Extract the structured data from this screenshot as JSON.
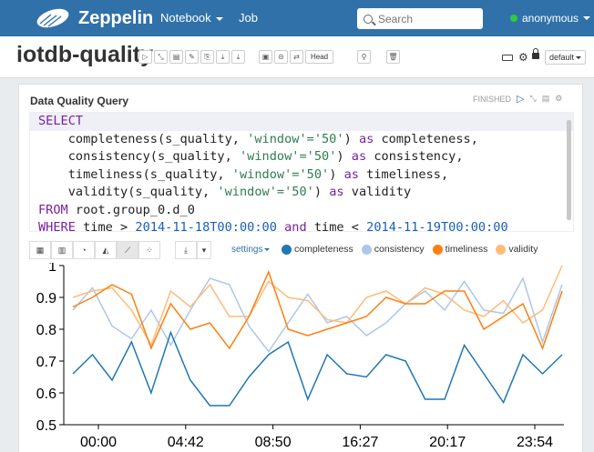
{
  "app": {
    "brand": "Zeppelin"
  },
  "nav": {
    "notebook": "Notebook",
    "job": "Job"
  },
  "search": {
    "placeholder": "Search"
  },
  "user": {
    "name": "anonymous"
  },
  "notebook": {
    "title": "iotdb-quality",
    "head_label": "Head",
    "interpreter": "default"
  },
  "paragraph": {
    "title": "Data Quality Query",
    "status": "FINISHED",
    "code": {
      "select": "SELECT",
      "f1_a": "    completeness(s_quality, ",
      "f1_s": "'window'='50'",
      "f1_b": ") ",
      "f1_as": "as",
      "f1_c": " completeness,",
      "f2_a": "    consistency(s_quality, ",
      "f2_s": "'window'='50'",
      "f2_b": ") ",
      "f2_as": "as",
      "f2_c": " consistency,",
      "f3_a": "    timeliness(s_quality, ",
      "f3_s": "'window'='50'",
      "f3_b": ") ",
      "f3_as": "as",
      "f3_c": " timeliness,",
      "f4_a": "    validity(s_quality, ",
      "f4_s": "'window'='50'",
      "f4_b": ") ",
      "f4_as": "as",
      "f4_c": " validity",
      "from_kw": "FROM",
      "from_rest": " root.group_0.d_0",
      "where_kw": "WHERE",
      "w1": " time > ",
      "d1": "2014-11-18T00:00:00",
      "and_kw": " and",
      "w2": " time < ",
      "d2": "2014-11-19T00:00:00"
    },
    "settings_label": "settings"
  },
  "colors": {
    "navbar": "#3071a9",
    "completeness": "#1f77b4",
    "consistency": "#aec7e8",
    "timeliness": "#ff7f0e",
    "validity": "#ffbb78"
  },
  "chart_data": {
    "type": "line",
    "x": [
      "00:00",
      "04:42",
      "08:50",
      "16:27",
      "20:17",
      "23:54"
    ],
    "ylim": [
      0.5,
      1
    ],
    "yticks": [
      0.5,
      0.6,
      0.7,
      0.8,
      0.9,
      1
    ],
    "series": [
      {
        "name": "completeness",
        "values": [
          0.66,
          0.72,
          0.64,
          0.76,
          0.6,
          0.79,
          0.64,
          0.56,
          0.56,
          0.65,
          0.72,
          0.76,
          0.58,
          0.72,
          0.66,
          0.65,
          0.72,
          0.7,
          0.58,
          0.58,
          0.75,
          0.66,
          0.57,
          0.72,
          0.66,
          0.72
        ]
      },
      {
        "name": "consistency",
        "values": [
          0.86,
          0.93,
          0.81,
          0.77,
          0.86,
          0.75,
          0.86,
          0.96,
          0.94,
          0.81,
          0.73,
          0.82,
          0.91,
          0.82,
          0.84,
          0.78,
          0.82,
          0.88,
          0.92,
          0.86,
          0.95,
          0.86,
          0.85,
          0.96,
          0.76,
          0.94
        ]
      },
      {
        "name": "timeliness",
        "values": [
          0.87,
          0.9,
          0.94,
          0.91,
          0.74,
          0.88,
          0.8,
          0.82,
          0.74,
          0.84,
          0.98,
          0.8,
          0.78,
          0.8,
          0.82,
          0.84,
          0.9,
          0.88,
          0.88,
          0.92,
          0.92,
          0.8,
          0.84,
          0.88,
          0.74,
          0.92
        ]
      },
      {
        "name": "validity",
        "values": [
          0.9,
          0.92,
          0.93,
          0.86,
          0.75,
          0.92,
          0.87,
          0.94,
          0.84,
          0.84,
          0.95,
          0.9,
          0.89,
          0.83,
          0.82,
          0.9,
          0.92,
          0.88,
          0.93,
          0.91,
          0.86,
          0.84,
          0.89,
          0.82,
          0.86,
          1.0
        ]
      }
    ]
  }
}
